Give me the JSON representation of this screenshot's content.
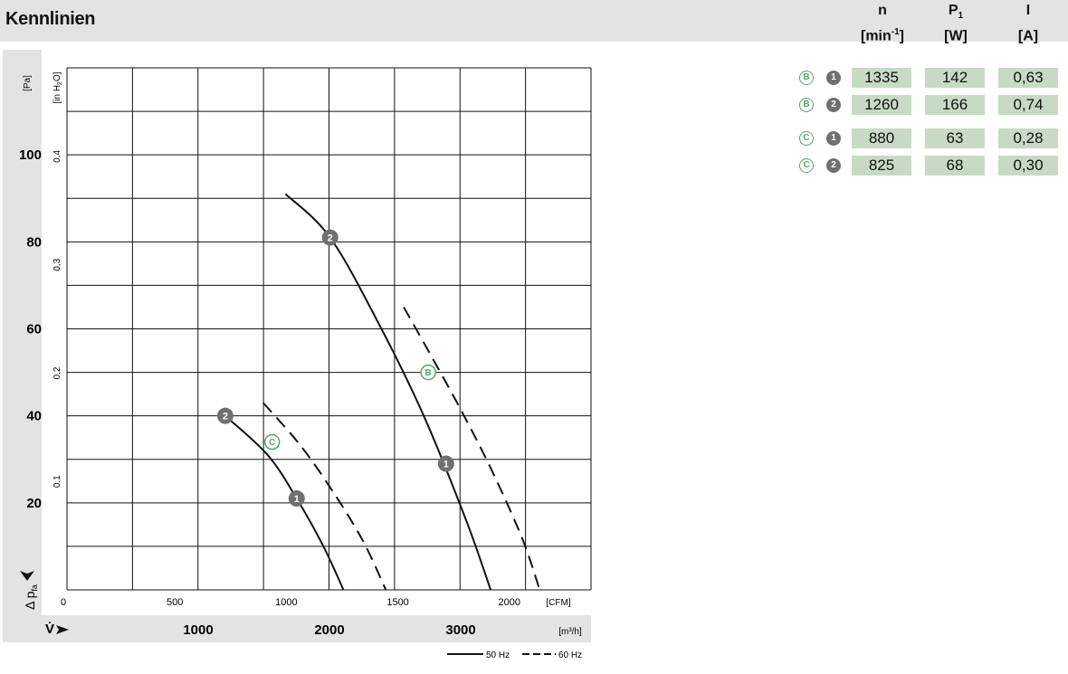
{
  "header": {
    "title": "Kennlinien",
    "columns": [
      {
        "symbol": "n",
        "sub": "",
        "unit_pre": "[min",
        "unit_sup": "-1",
        "unit_post": "]"
      },
      {
        "symbol": "P",
        "sub": "1",
        "unit_pre": "[W]",
        "unit_sup": "",
        "unit_post": ""
      },
      {
        "symbol": "I",
        "sub": "",
        "unit_pre": "[A]",
        "unit_sup": "",
        "unit_post": ""
      }
    ]
  },
  "table": {
    "rows": [
      {
        "curve": "B",
        "point": "1",
        "n": "1335",
        "p1": "142",
        "i": "0,63"
      },
      {
        "curve": "B",
        "point": "2",
        "n": "1260",
        "p1": "166",
        "i": "0,74"
      },
      {
        "curve": "C",
        "point": "1",
        "n": "880",
        "p1": "63",
        "i": "0,28"
      },
      {
        "curve": "C",
        "point": "2",
        "n": "825",
        "p1": "68",
        "i": "0,30"
      }
    ]
  },
  "chart_data": {
    "type": "line",
    "x_unit": "[CFM]",
    "x_range": [
      0,
      2350
    ],
    "x_ticks": [
      0,
      500,
      1000,
      1500,
      2000
    ],
    "x2_unit": "[m³/h]",
    "x2_ticks": [
      1000,
      2000,
      3000
    ],
    "x2_label": "V̇",
    "y_unit": "[Pa]",
    "y_range": [
      0,
      120
    ],
    "y_ticks": [
      20,
      40,
      60,
      80,
      100
    ],
    "y_label": "Δ p",
    "y_label_sub": "fa",
    "y2_unit": "[in H",
    "y2_unit_sub": "2",
    "y2_unit_post": "O]",
    "y2_ticks": [
      0.1,
      0.2,
      0.3,
      0.4
    ],
    "y2_tick_labels": [
      "0,1",
      "0,2",
      "0,3",
      "0,4"
    ],
    "grid": true,
    "legend": [
      {
        "label": "50 Hz",
        "style": "solid"
      },
      {
        "label": "60 Hz",
        "style": "dashed"
      }
    ],
    "series": [
      {
        "style": "solid",
        "points": [
          [
            710,
            40
          ],
          [
            900,
            31
          ],
          [
            1030,
            21
          ],
          [
            1150,
            10
          ],
          [
            1240,
            0
          ]
        ]
      },
      {
        "style": "dashed",
        "points": [
          [
            880,
            43
          ],
          [
            1050,
            33
          ],
          [
            1200,
            22
          ],
          [
            1330,
            11
          ],
          [
            1430,
            0
          ]
        ]
      },
      {
        "style": "solid",
        "points": [
          [
            980,
            91
          ],
          [
            1180,
            81
          ],
          [
            1400,
            61
          ],
          [
            1600,
            40
          ],
          [
            1790,
            16
          ],
          [
            1900,
            0
          ]
        ]
      },
      {
        "style": "dashed",
        "points": [
          [
            1510,
            65
          ],
          [
            1620,
            55
          ],
          [
            1760,
            42
          ],
          [
            1900,
            28
          ],
          [
            2040,
            12
          ],
          [
            2120,
            0
          ]
        ]
      }
    ],
    "markers": [
      {
        "label": "2",
        "kind": "point",
        "x": 710,
        "y": 40
      },
      {
        "label": "1",
        "kind": "point",
        "x": 1030,
        "y": 21
      },
      {
        "label": "C",
        "kind": "curve",
        "x": 920,
        "y": 34
      },
      {
        "label": "2",
        "kind": "point",
        "x": 1180,
        "y": 81
      },
      {
        "label": "1",
        "kind": "point",
        "x": 1700,
        "y": 29
      },
      {
        "label": "B",
        "kind": "curve",
        "x": 1620,
        "y": 50
      }
    ],
    "colors": {
      "point_marker": "#707070",
      "curve_marker": "#5aa36e",
      "table_cell": "#c7dbc4",
      "band": "#e3e3e3"
    }
  }
}
